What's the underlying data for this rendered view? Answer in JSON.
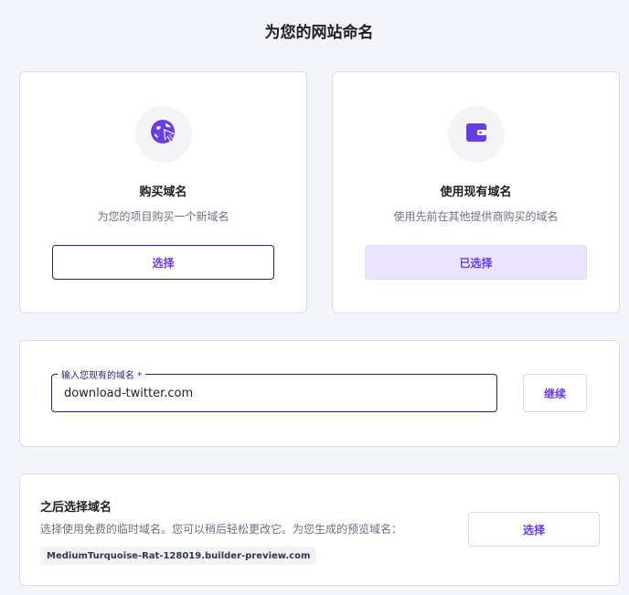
{
  "page": {
    "title": "为您的网站命名"
  },
  "colors": {
    "accent": "#673de6",
    "dark_navy": "#2f1c6a",
    "selected_bg": "#ebe4ff",
    "page_bg": "#f4f4fb"
  },
  "options": {
    "buy": {
      "icon": "globe-cursor-icon",
      "title": "购买域名",
      "description": "为您的项目购买一个新域名",
      "button_label": "选择"
    },
    "existing": {
      "icon": "wallet-icon",
      "title": "使用现有域名",
      "description": "使用先前在其他提供商购买的域名",
      "button_label": "已选择",
      "selected": true
    }
  },
  "domain_input": {
    "label": "输入您现有的域名 *",
    "value": "download-twitter.com",
    "continue_label": "继续"
  },
  "choose_later": {
    "title": "之后选择域名",
    "description": "选择使用免费的临时域名。您可以稍后轻松更改它。为您生成的预览域名：",
    "preview_domain": "MediumTurquoise-Rat-128019.builder-preview.com",
    "button_label": "选择"
  }
}
